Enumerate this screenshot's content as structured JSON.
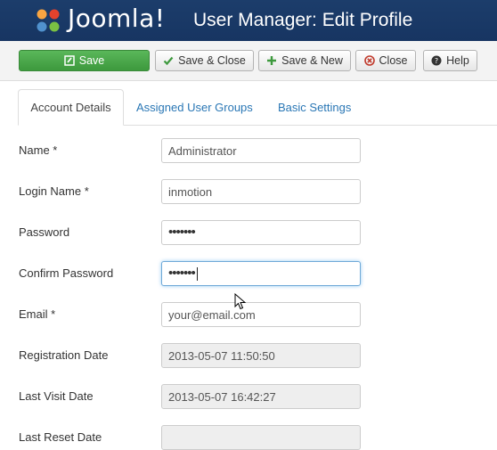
{
  "header": {
    "logo_text": "Joomla!",
    "title": "User Manager: Edit Profile",
    "logo_icon": "joomla-logo-icon"
  },
  "toolbar": {
    "save": "Save",
    "save_close": "Save & Close",
    "save_new": "Save & New",
    "close": "Close",
    "help": "Help",
    "icons": [
      "edit-icon",
      "check-icon",
      "plus-icon",
      "cancel-icon",
      "question-icon"
    ],
    "save_color": "#4fae4f"
  },
  "tabs": {
    "account": "Account Details",
    "groups": "Assigned User Groups",
    "basic": "Basic Settings",
    "active": "Account Details"
  },
  "form": {
    "name": {
      "label": "Name *",
      "value": "Administrator"
    },
    "login": {
      "label": "Login Name *",
      "value": "inmotion"
    },
    "password": {
      "label": "Password",
      "value": "•••••••"
    },
    "confirm": {
      "label": "Confirm Password",
      "value": "•••••••"
    },
    "email": {
      "label": "Email *",
      "value": "your@email.com"
    },
    "reg_date": {
      "label": "Registration Date",
      "value": "2013-05-07 11:50:50"
    },
    "visit_date": {
      "label": "Last Visit Date",
      "value": "2013-05-07 16:42:27"
    },
    "reset_date": {
      "label": "Last Reset Date",
      "value": ""
    }
  },
  "colors": {
    "header_bg": "#1c3d6b",
    "link": "#2a77b5",
    "focus_border": "#6fa9d7"
  }
}
